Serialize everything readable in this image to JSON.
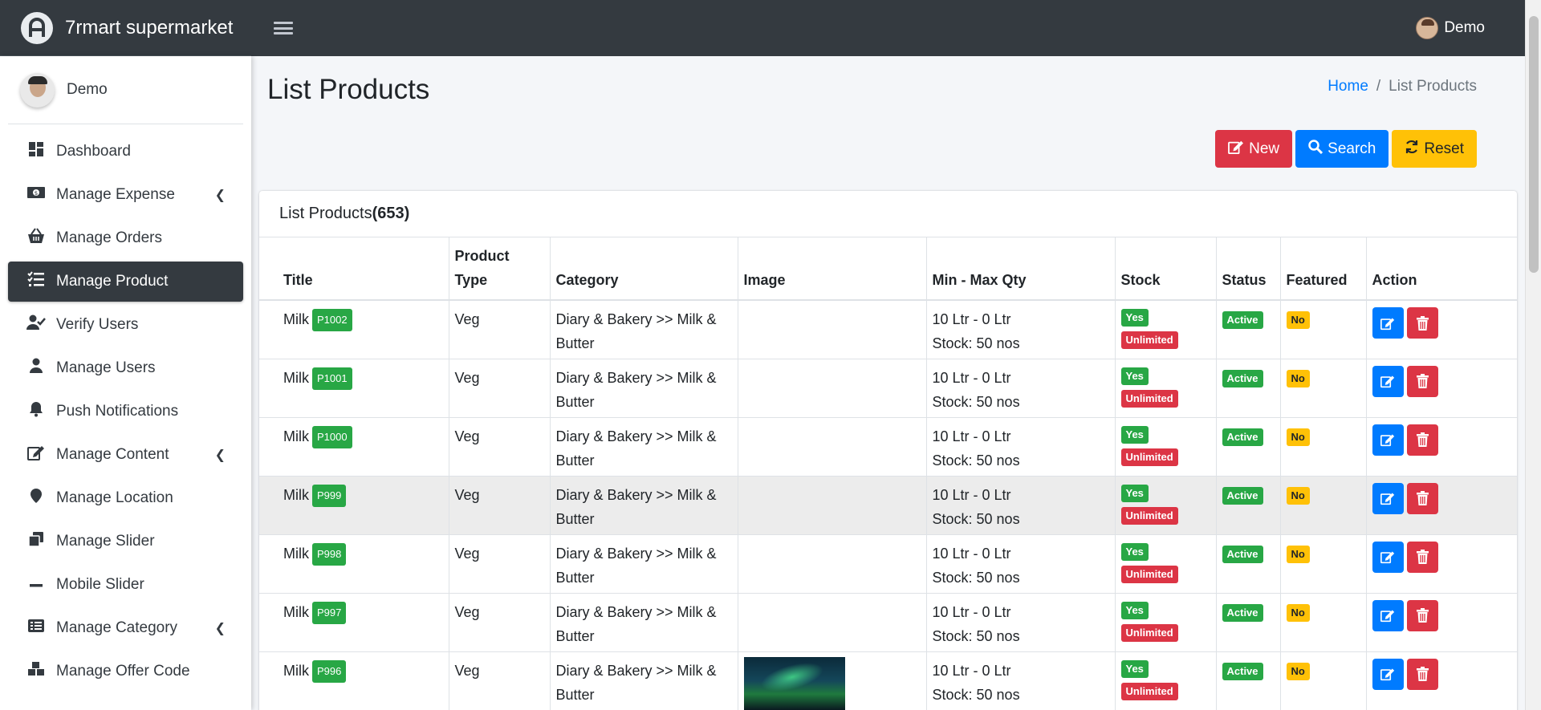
{
  "app": {
    "title": "7rmart supermarket"
  },
  "topbar": {
    "user_name": "Demo"
  },
  "sidebar": {
    "user_name": "Demo",
    "items": [
      {
        "label": "Dashboard",
        "icon": "dashboard-icon"
      },
      {
        "label": "Manage Expense",
        "icon": "money-icon",
        "has_children": true
      },
      {
        "label": "Manage Orders",
        "icon": "basket-icon"
      },
      {
        "label": "Manage Product",
        "icon": "list-icon",
        "active": true
      },
      {
        "label": "Verify Users",
        "icon": "user-check-icon"
      },
      {
        "label": "Manage Users",
        "icon": "user-icon"
      },
      {
        "label": "Push Notifications",
        "icon": "bell-icon"
      },
      {
        "label": "Manage Content",
        "icon": "edit-icon",
        "has_children": true
      },
      {
        "label": "Manage Location",
        "icon": "map-marker-icon"
      },
      {
        "label": "Manage Slider",
        "icon": "clone-icon"
      },
      {
        "label": "Mobile Slider",
        "icon": "minus-icon"
      },
      {
        "label": "Manage Category",
        "icon": "list-alt-icon",
        "has_children": true
      },
      {
        "label": "Manage Offer Code",
        "icon": "cubes-icon"
      }
    ]
  },
  "page": {
    "title": "List Products",
    "breadcrumb": {
      "home": "Home",
      "current": "List Products"
    },
    "buttons": {
      "new": "New",
      "search": "Search",
      "reset": "Reset"
    }
  },
  "card": {
    "title": "List Products",
    "count": "(653)"
  },
  "table": {
    "headers": {
      "title": "Title",
      "product_type": "Product Type",
      "category": "Category",
      "image": "Image",
      "qty": "Min - Max Qty",
      "stock": "Stock",
      "status": "Status",
      "featured": "Featured",
      "action": "Action"
    },
    "rows": [
      {
        "title": "Milk",
        "code": "P1002",
        "type": "Veg",
        "category": "Diary & Bakery >> Milk & Butter",
        "qty": "10 Ltr - 0 Ltr",
        "stock_text": "Stock: 50 nos",
        "stock_yes": "Yes",
        "stock_unl": "Unlimited",
        "status": "Active",
        "featured": "No"
      },
      {
        "title": "Milk",
        "code": "P1001",
        "type": "Veg",
        "category": "Diary & Bakery >> Milk & Butter",
        "qty": "10 Ltr - 0 Ltr",
        "stock_text": "Stock: 50 nos",
        "stock_yes": "Yes",
        "stock_unl": "Unlimited",
        "status": "Active",
        "featured": "No"
      },
      {
        "title": "Milk",
        "code": "P1000",
        "type": "Veg",
        "category": "Diary & Bakery >> Milk & Butter",
        "qty": "10 Ltr - 0 Ltr",
        "stock_text": "Stock: 50 nos",
        "stock_yes": "Yes",
        "stock_unl": "Unlimited",
        "status": "Active",
        "featured": "No"
      },
      {
        "title": "Milk",
        "code": "P999",
        "type": "Veg",
        "category": "Diary & Bakery >> Milk & Butter",
        "qty": "10 Ltr - 0 Ltr",
        "stock_text": "Stock: 50 nos",
        "stock_yes": "Yes",
        "stock_unl": "Unlimited",
        "status": "Active",
        "featured": "No"
      },
      {
        "title": "Milk",
        "code": "P998",
        "type": "Veg",
        "category": "Diary & Bakery >> Milk & Butter",
        "qty": "10 Ltr - 0 Ltr",
        "stock_text": "Stock: 50 nos",
        "stock_yes": "Yes",
        "stock_unl": "Unlimited",
        "status": "Active",
        "featured": "No"
      },
      {
        "title": "Milk",
        "code": "P997",
        "type": "Veg",
        "category": "Diary & Bakery >> Milk & Butter",
        "qty": "10 Ltr - 0 Ltr",
        "stock_text": "Stock: 50 nos",
        "stock_yes": "Yes",
        "stock_unl": "Unlimited",
        "status": "Active",
        "featured": "No"
      },
      {
        "title": "Milk",
        "code": "P996",
        "type": "Veg",
        "category": "Diary & Bakery >> Milk & Butter",
        "qty": "10 Ltr - 0 Ltr",
        "stock_text": "Stock: 50 nos",
        "stock_yes": "Yes",
        "stock_unl": "Unlimited",
        "status": "Active",
        "featured": "No"
      }
    ]
  },
  "colors": {
    "dark": "#343a40",
    "primary": "#007bff",
    "danger": "#dc3545",
    "success": "#28a745",
    "warning": "#ffc107"
  }
}
